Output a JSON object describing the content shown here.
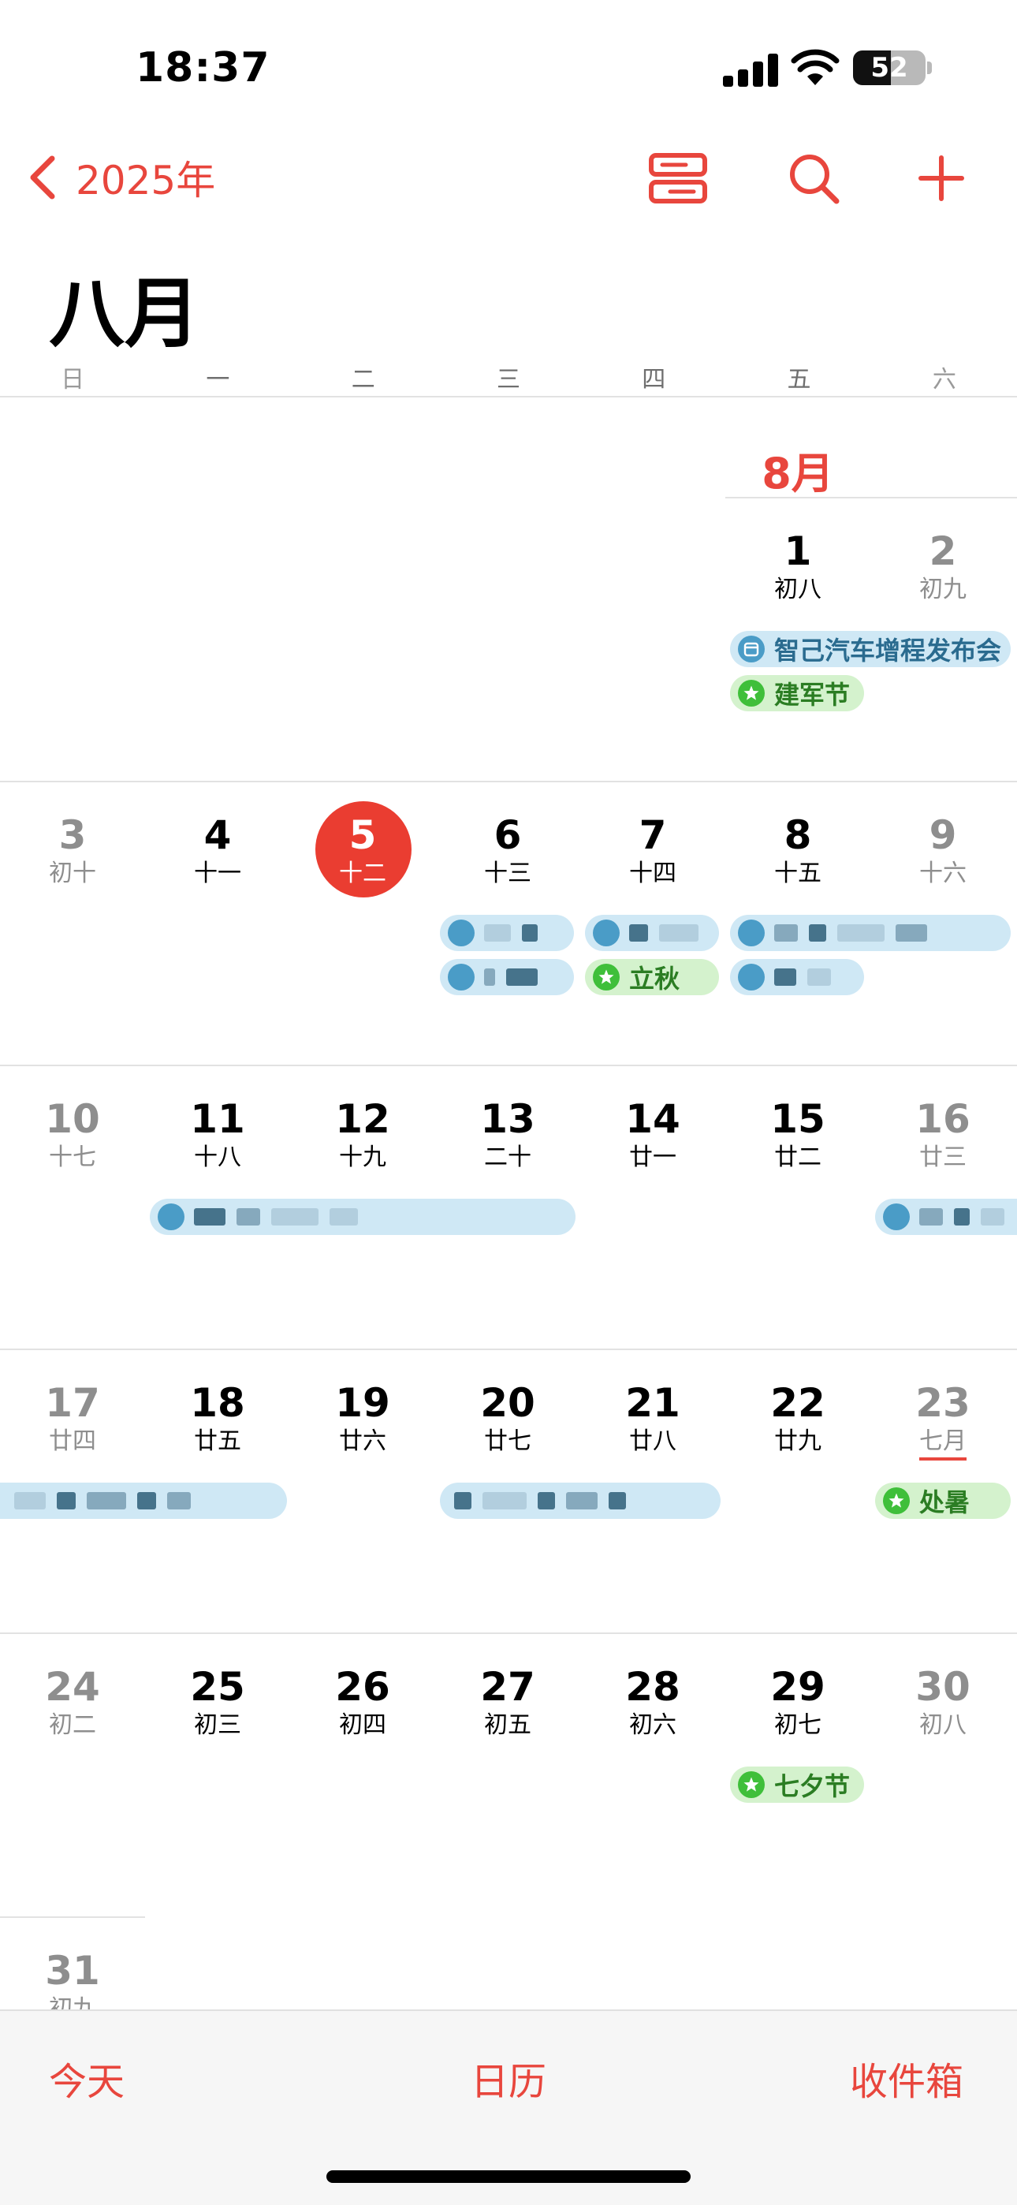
{
  "status": {
    "time": "18:37",
    "battery": "52",
    "battery_level": 0.52
  },
  "nav": {
    "back_label": "2025年",
    "month_title": "八月",
    "icons": [
      "list-view-icon",
      "search-icon",
      "add-icon"
    ]
  },
  "weekdays": [
    "日",
    "一",
    "二",
    "三",
    "四",
    "五",
    "六"
  ],
  "month_label": "8月",
  "weeks": [
    [
      {
        "d": "",
        "l": ""
      },
      {
        "d": "",
        "l": ""
      },
      {
        "d": "",
        "l": ""
      },
      {
        "d": "",
        "l": ""
      },
      {
        "d": "",
        "l": ""
      },
      {
        "d": "1",
        "l": "初八"
      },
      {
        "d": "2",
        "l": "初九"
      }
    ],
    [
      {
        "d": "3",
        "l": "初十"
      },
      {
        "d": "4",
        "l": "十一"
      },
      {
        "d": "5",
        "l": "十二"
      },
      {
        "d": "6",
        "l": "十三"
      },
      {
        "d": "7",
        "l": "十四"
      },
      {
        "d": "8",
        "l": "十五"
      },
      {
        "d": "9",
        "l": "十六"
      }
    ],
    [
      {
        "d": "10",
        "l": "十七"
      },
      {
        "d": "11",
        "l": "十八"
      },
      {
        "d": "12",
        "l": "十九"
      },
      {
        "d": "13",
        "l": "二十"
      },
      {
        "d": "14",
        "l": "廿一"
      },
      {
        "d": "15",
        "l": "廿二"
      },
      {
        "d": "16",
        "l": "廿三"
      }
    ],
    [
      {
        "d": "17",
        "l": "廿四"
      },
      {
        "d": "18",
        "l": "廿五"
      },
      {
        "d": "19",
        "l": "廿六"
      },
      {
        "d": "20",
        "l": "廿七"
      },
      {
        "d": "21",
        "l": "廿八"
      },
      {
        "d": "22",
        "l": "廿九"
      },
      {
        "d": "23",
        "l": "七月"
      }
    ],
    [
      {
        "d": "24",
        "l": "初二"
      },
      {
        "d": "25",
        "l": "初三"
      },
      {
        "d": "26",
        "l": "初四"
      },
      {
        "d": "27",
        "l": "初五"
      },
      {
        "d": "28",
        "l": "初六"
      },
      {
        "d": "29",
        "l": "初七"
      },
      {
        "d": "30",
        "l": "初八"
      }
    ],
    [
      {
        "d": "31",
        "l": "初九"
      }
    ]
  ],
  "events": {
    "launch": "智己汽车增程发布会",
    "army_day": "建军节",
    "liqiu": "立秋",
    "chushu": "处暑",
    "qixi": "七夕节"
  },
  "tabs": {
    "today": "今天",
    "calendars": "日历",
    "inbox": "收件箱"
  },
  "colors": {
    "accent": "#e8463d",
    "today": "#ea3d31",
    "calendar_event": "#cfe8f5",
    "holiday_event": "#d4f2cd"
  }
}
